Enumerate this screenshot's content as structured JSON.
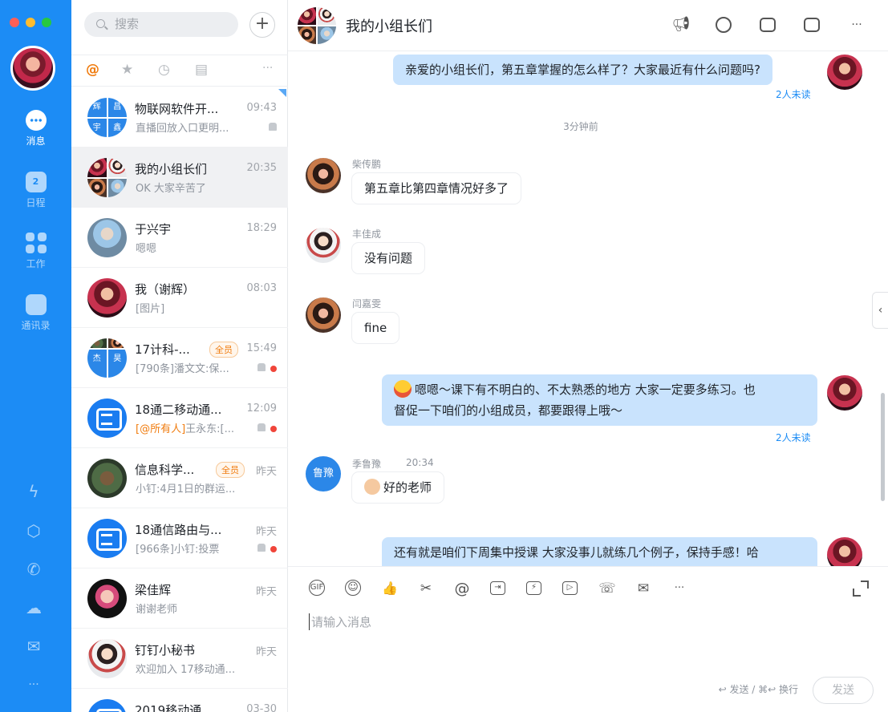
{
  "rail": {
    "nav": [
      {
        "label": "消息",
        "active": true
      },
      {
        "label": "日程",
        "day": "2"
      },
      {
        "label": "工作"
      },
      {
        "label": "通讯录"
      }
    ],
    "more": "···"
  },
  "list": {
    "search_placeholder": "搜索",
    "plus": "+",
    "filter_at": "@",
    "filter_more": "···",
    "conversations": [
      {
        "name": "物联网软件开...",
        "time": "09:43",
        "preview": "直播回放入口更明...",
        "tiles": [
          "辉",
          "昌",
          "宇",
          "鑫"
        ]
      },
      {
        "name": "我的小组长们",
        "time": "20:35",
        "preview": "OK 大家辛苦了"
      },
      {
        "name": "于兴宇",
        "time": "18:29",
        "preview": "嗯嗯"
      },
      {
        "name": "我（谢辉）",
        "time": "08:03",
        "preview": "[图片]"
      },
      {
        "name": "17计科-...",
        "time": "15:49",
        "badge": "全员",
        "preview": "[790条]潘文文:保...",
        "tiles": [
          "杰",
          "昊"
        ]
      },
      {
        "name": "18通二移动通...",
        "time": "12:09",
        "preview_hl": "[@所有人]",
        "preview": "王永东:[..."
      },
      {
        "name": "信息科学...",
        "time": "昨天",
        "badge": "全员",
        "preview": "小钉:4月1日的群运..."
      },
      {
        "name": "18通信路由与...",
        "time": "昨天",
        "preview": "[966条]小钉:投票"
      },
      {
        "name": "梁佳辉",
        "time": "昨天",
        "preview": "谢谢老师"
      },
      {
        "name": "钉钉小秘书",
        "time": "昨天",
        "preview": "欢迎加入 17移动通..."
      },
      {
        "name": "2019移动通...",
        "time": "03-30",
        "preview": ""
      }
    ]
  },
  "chat": {
    "title": "我的小组长们",
    "header_more": "···",
    "messages": [
      {
        "text": "亲爱的小组长们，第五章掌握的怎么样了？大家最近有什么问题吗?",
        "unread": "2人未读"
      },
      {
        "timestamp": "3分钟前"
      },
      {
        "sender": "柴传鹏",
        "text": "第五章比第四章情况好多了"
      },
      {
        "sender": "丰佳成",
        "text": "没有问题"
      },
      {
        "sender": "闫嘉雯",
        "text": "fine"
      },
      {
        "text_line1": "嗯嗯～课下有不明白的、不太熟悉的地方 大家一定要多练习。也",
        "text_line2": "督促一下咱们的小组成员，都要跟得上哦～",
        "unread": "2人未读"
      },
      {
        "sender": "季鲁豫",
        "time": "20:34",
        "avatar_text": "鲁豫",
        "text": "好的老师"
      },
      {
        "text": "还有就是咱们下周集中授课 大家没事儿就练几个例子，保持手感！哈"
      }
    ],
    "toolbar": [
      "GIF",
      "☺",
      "👍",
      "✂",
      "@",
      "⇥",
      "⚡",
      "▷",
      "☏",
      "✉",
      "···"
    ],
    "input_placeholder": "请输入消息",
    "send_hint": "↩ 发送 / ⌘↩ 换行",
    "send_label": "发送",
    "collapse": "‹"
  }
}
